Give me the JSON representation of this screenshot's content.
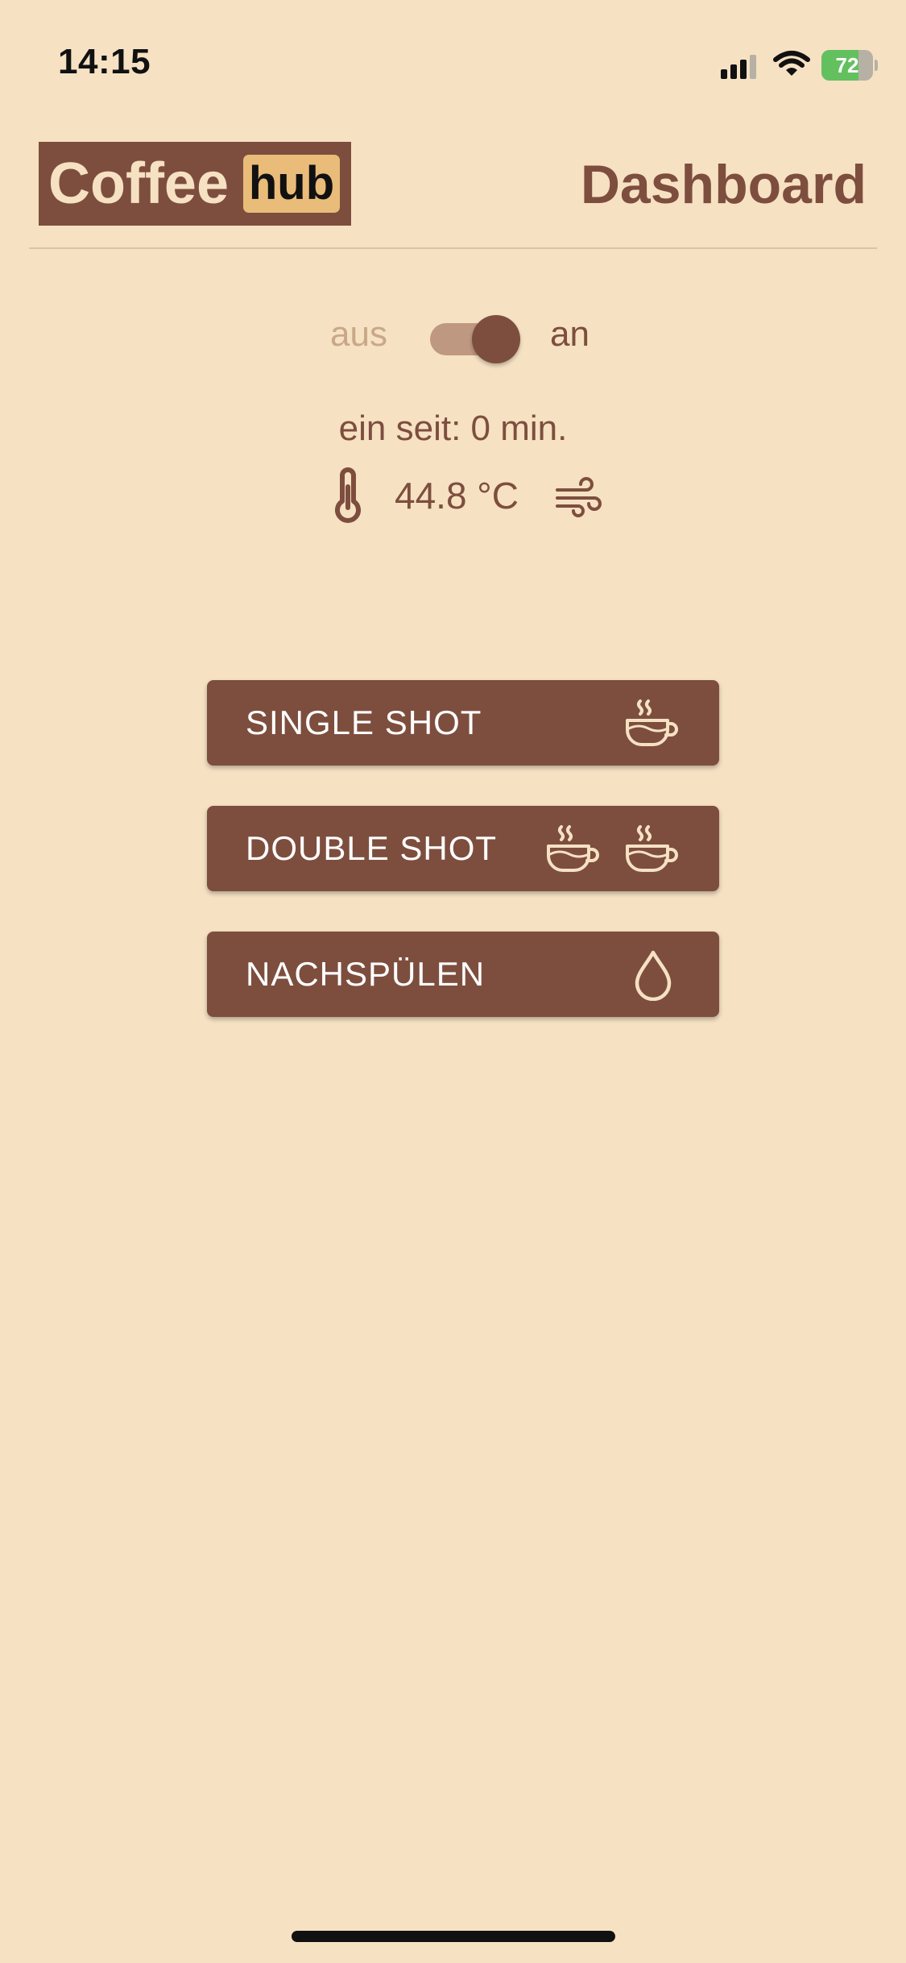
{
  "status_bar": {
    "time": "14:15",
    "battery_percent": "72",
    "battery_level": 0.72,
    "icons": [
      "signal-icon",
      "wifi-icon",
      "battery-icon"
    ]
  },
  "header": {
    "logo_part1": "Coffee",
    "logo_part2": "hub",
    "title": "Dashboard"
  },
  "power": {
    "off_label": "aus",
    "on_label": "an",
    "state": "on",
    "uptime_text": "ein seit: 0 min."
  },
  "temperature": {
    "value_text": "44.8 °C",
    "icons": [
      "thermometer-icon",
      "wind-icon"
    ]
  },
  "actions": [
    {
      "label": "SINGLE SHOT",
      "icon": "coffee-cup-icon"
    },
    {
      "label": "DOUBLE SHOT",
      "icon": "coffee-cup-icon"
    },
    {
      "label": "NACHSPÜLEN",
      "icon": "water-drop-icon"
    }
  ],
  "colors": {
    "background": "#F6E1C3",
    "primary": "#7D4E3E",
    "logo_highlight": "#E9BC79",
    "icon_cream": "#F6E1C3",
    "battery_green": "#63C05E"
  }
}
